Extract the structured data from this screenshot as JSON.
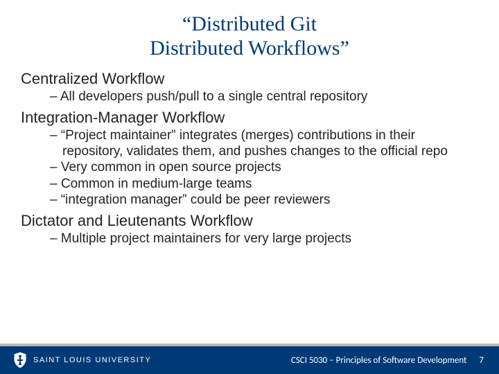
{
  "title_line1": "“Distributed Git",
  "title_line2": "Distributed Workflows”",
  "section1": {
    "heading": "Centralized Workflow",
    "bullets": [
      "All developers push/pull to a single central repository"
    ]
  },
  "section2": {
    "heading": "Integration-Manager Workflow",
    "bullets": [
      "“Project maintainer” integrates (merges) contributions in their repository, validates them, and pushes changes to the official repo",
      "Very common in open source projects",
      "Common in medium-large teams",
      "“integration manager” could be peer reviewers"
    ]
  },
  "section3": {
    "heading": "Dictator and Lieutenants Workflow",
    "bullets": [
      "Multiple project maintainers for very large projects"
    ]
  },
  "footer": {
    "logo_text": "SAINT LOUIS UNIVERSITY",
    "course": "CSCI 5030 – Principles of Software Development",
    "page": "7"
  }
}
